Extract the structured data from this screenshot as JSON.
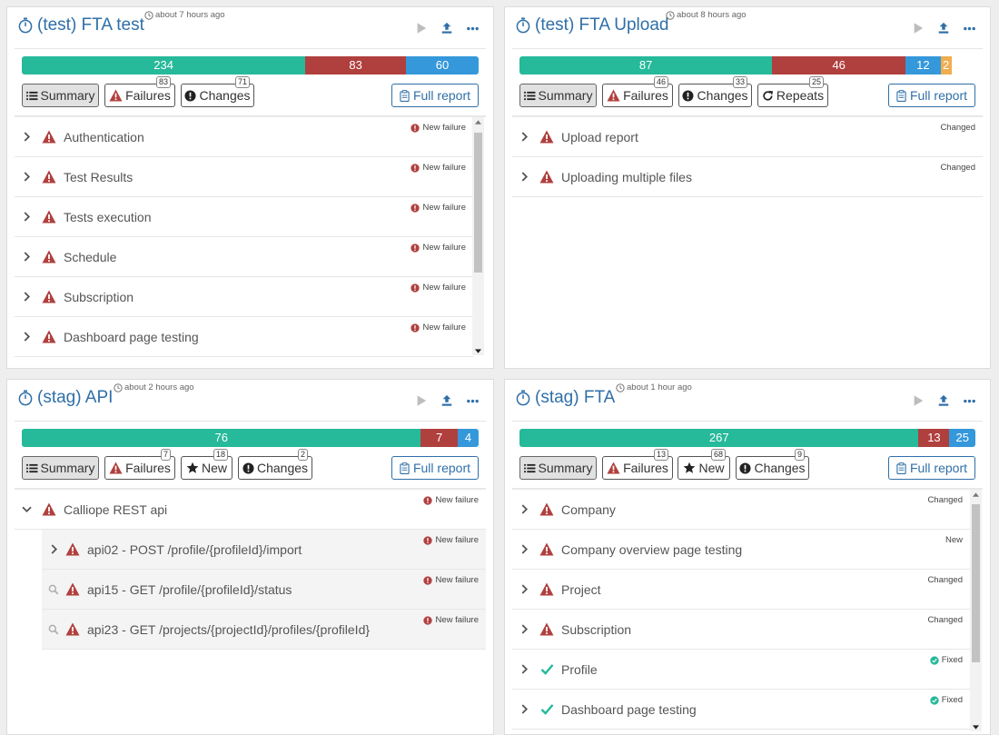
{
  "colors": {
    "passed": "#26b99a",
    "failed": "#b0403e",
    "skipped": "#3498db",
    "other": "#f0ad4e",
    "link": "#2f6fa8"
  },
  "panels": {
    "fta_test": {
      "title": "(test) FTA test",
      "ago": "about 7 hours ago",
      "progress": {
        "passed": 234,
        "failed": 83,
        "skipped": 60
      },
      "buttons": {
        "summary": "Summary",
        "failures": "Failures",
        "failures_count": "83",
        "changes": "Changes",
        "changes_count": "71",
        "full_report": "Full report"
      },
      "rows": [
        {
          "label": "Authentication",
          "status": "New failure"
        },
        {
          "label": "Test Results",
          "status": "New failure"
        },
        {
          "label": "Tests execution",
          "status": "New failure"
        },
        {
          "label": "Schedule",
          "status": "New failure"
        },
        {
          "label": "Subscription",
          "status": "New failure"
        },
        {
          "label": "Dashboard page testing",
          "status": "New failure"
        }
      ]
    },
    "fta_upload": {
      "title": "(test) FTA Upload",
      "ago": "about 8 hours ago",
      "progress": {
        "passed": 87,
        "failed": 46,
        "skipped": 12,
        "other": 2
      },
      "buttons": {
        "summary": "Summary",
        "failures": "Failures",
        "failures_count": "46",
        "changes": "Changes",
        "changes_count": "33",
        "repeats": "Repeats",
        "repeats_count": "25",
        "full_report": "Full report"
      },
      "rows": [
        {
          "label": "Upload report",
          "status": "Changed"
        },
        {
          "label": "Uploading multiple files",
          "status": "Changed"
        }
      ]
    },
    "stag_api": {
      "title": "(stag) API",
      "ago": "about 2 hours ago",
      "progress": {
        "passed": 76,
        "failed": 7,
        "skipped": 4
      },
      "buttons": {
        "summary": "Summary",
        "failures": "Failures",
        "failures_count": "7",
        "new": "New",
        "new_count": "18",
        "changes": "Changes",
        "changes_count": "2",
        "full_report": "Full report"
      },
      "rows": [
        {
          "label": "Calliope REST api",
          "status": "New failure"
        },
        {
          "label": "api02 - POST /profile/{profileId}/import",
          "status": "New failure"
        },
        {
          "label": "api15 - GET /profile/{profileId}/status",
          "status": "New failure"
        },
        {
          "label": "api23 - GET /projects/{projectId}/profiles/{profileId}",
          "status": "New failure"
        }
      ]
    },
    "stag_fta": {
      "title": "(stag) FTA",
      "ago": "about 1 hour ago",
      "progress": {
        "passed": 267,
        "failed": 13,
        "skipped": 25
      },
      "buttons": {
        "summary": "Summary",
        "failures": "Failures",
        "failures_count": "13",
        "new": "New",
        "new_count": "68",
        "changes": "Changes",
        "changes_count": "9",
        "full_report": "Full report"
      },
      "rows": [
        {
          "label": "Company",
          "status": "Changed"
        },
        {
          "label": "Company overview page testing",
          "status": "New"
        },
        {
          "label": "Project",
          "status": "Changed"
        },
        {
          "label": "Subscription",
          "status": "Changed"
        },
        {
          "label": "Profile",
          "status": "Fixed"
        },
        {
          "label": "Dashboard page testing",
          "status": "Fixed"
        }
      ]
    }
  }
}
